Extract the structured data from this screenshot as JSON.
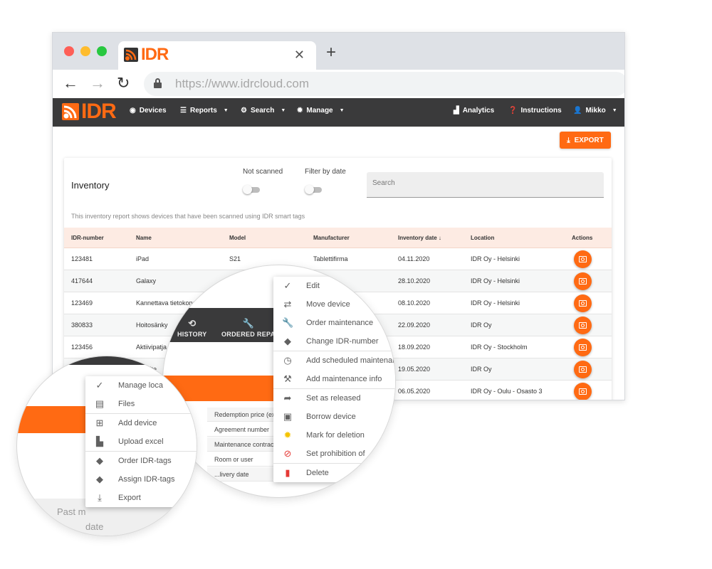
{
  "browser": {
    "tab_title": "IDR",
    "url": "https://www.idrcloud.com",
    "icons": {
      "back": "arrow-left-icon",
      "forward": "arrow-right-icon",
      "reload": "reload-icon",
      "lock": "lock-icon",
      "close_tab": "close-icon",
      "new_tab": "plus-icon"
    }
  },
  "navbar": {
    "logo_text": "IDR",
    "items": [
      {
        "label": "Devices",
        "icon": "eye-icon",
        "dropdown": false
      },
      {
        "label": "Reports",
        "icon": "list-icon",
        "dropdown": true
      },
      {
        "label": "Search",
        "icon": "search-settings-icon",
        "dropdown": true
      },
      {
        "label": "Manage",
        "icon": "gear-icon",
        "dropdown": true
      }
    ],
    "right_items": [
      {
        "label": "Analytics",
        "icon": "bar-chart-icon",
        "dropdown": false
      },
      {
        "label": "Instructions",
        "icon": "help-icon",
        "dropdown": false
      },
      {
        "label": "Mikko",
        "icon": "user-icon",
        "dropdown": true
      }
    ]
  },
  "export_button": {
    "label": "EXPORT",
    "icon": "download-icon"
  },
  "inventory": {
    "title": "Inventory",
    "toggles": [
      {
        "label": "Not scanned",
        "on": false
      },
      {
        "label": "Filter by date",
        "on": false
      }
    ],
    "search_placeholder": "Search",
    "description": "This inventory report shows devices that have been scanned using IDR smart tags",
    "columns": [
      "IDR-number",
      "Name",
      "Model",
      "Manufacturer",
      "Inventory date ↓",
      "Location",
      "Actions"
    ],
    "rows": [
      {
        "idr": "123481",
        "name": "iPad",
        "model": "S21",
        "manufacturer": "Tablettifirma",
        "date": "04.11.2020",
        "location": "IDR Oy - Helsinki"
      },
      {
        "idr": "417644",
        "name": "Galaxy",
        "model": "",
        "manufacturer": "",
        "date": "28.10.2020",
        "location": "IDR Oy - Helsinki"
      },
      {
        "idr": "123469",
        "name": "Kannettava tietokone",
        "model": "",
        "manufacturer": "",
        "date": "08.10.2020",
        "location": "IDR Oy - Helsinki"
      },
      {
        "idr": "380833",
        "name": "Hoitosänky",
        "model": "",
        "manufacturer": "",
        "date": "22.09.2020",
        "location": "IDR Oy"
      },
      {
        "idr": "123456",
        "name": "Aktiivipatja",
        "model": "",
        "manufacturer": "",
        "date": "18.09.2020",
        "location": "IDR Oy - Stockholm"
      },
      {
        "idr": "",
        "name": "...olaite",
        "model": "",
        "manufacturer": "",
        "date": "19.05.2020",
        "location": "IDR Oy"
      },
      {
        "idr": "",
        "name": "",
        "model": "",
        "manufacturer": "",
        "date": "06.05.2020",
        "location": "IDR Oy - Oulu - Osasto 3"
      }
    ]
  },
  "device_menu": {
    "tabs": [
      {
        "label": "HISTORY",
        "icon": "history-icon"
      },
      {
        "label": "ORDERED REPA",
        "icon": "wrench-icon"
      }
    ],
    "detail_rows": [
      "Redemption price (ex",
      "Agreement number",
      "Maintenance contrac",
      "Room or user",
      "...livery date"
    ],
    "items": [
      {
        "label": "Edit",
        "icon": "edit-icon",
        "color": "#616161"
      },
      {
        "label": "Move device",
        "icon": "swap-icon",
        "color": "#616161"
      },
      {
        "label": "Order maintenance",
        "icon": "wrench-icon",
        "color": "#616161"
      },
      {
        "label": "Change IDR-number",
        "icon": "tags-icon",
        "color": "#616161",
        "sep_after": true
      },
      {
        "label": "Add scheduled maintenance",
        "icon": "clock-icon",
        "color": "#616161"
      },
      {
        "label": "Add maintenance info",
        "icon": "tools-icon",
        "color": "#616161",
        "sep_after": true
      },
      {
        "label": "Set as released",
        "icon": "share-arrow-icon",
        "color": "#616161"
      },
      {
        "label": "Borrow device",
        "icon": "calendar-download-icon",
        "color": "#616161"
      },
      {
        "label": "Mark for deletion",
        "icon": "warning-badge-icon",
        "color": "#f5c400"
      },
      {
        "label": "Set prohibition of",
        "icon": "block-icon",
        "color": "#e53935",
        "sep_after": true
      },
      {
        "label": "Delete",
        "icon": "trash-icon",
        "color": "#e53935"
      }
    ]
  },
  "manage_menu": {
    "items": [
      {
        "label": "Manage loca",
        "icon": "edit-icon"
      },
      {
        "label": "Files",
        "icon": "files-icon",
        "sep_after": true
      },
      {
        "label": "Add device",
        "icon": "add-box-icon"
      },
      {
        "label": "Upload excel",
        "icon": "upload-file-icon",
        "sep_after": true
      },
      {
        "label": "Order IDR-tags",
        "icon": "tag-icon"
      },
      {
        "label": "Assign IDR-tags",
        "icon": "tags-icon"
      },
      {
        "label": "Export",
        "icon": "download-icon"
      }
    ],
    "background_text": [
      "Past m",
      "date"
    ]
  },
  "colors": {
    "brand": "#ff6a13",
    "navbar": "#3a3a3b",
    "table_header": "#fdebe3"
  }
}
